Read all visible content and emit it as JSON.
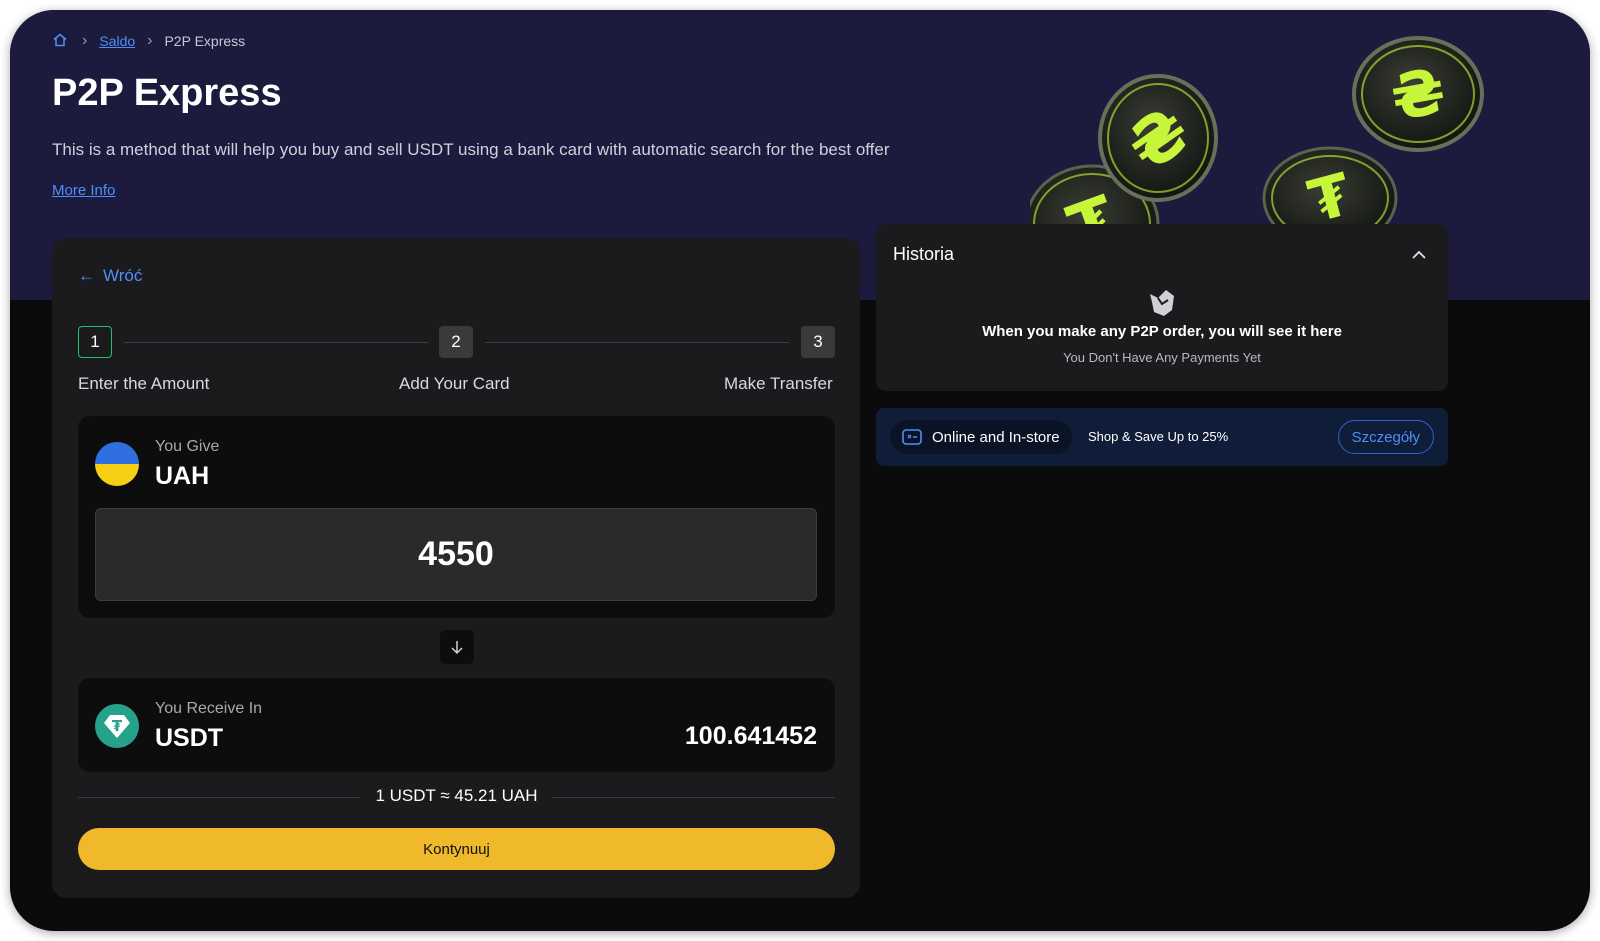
{
  "breadcrumb": {
    "home": "home",
    "saldo": "Saldo",
    "current": "P2P Express"
  },
  "hero": {
    "title": "P2P Express",
    "description": "This is a method that will help you buy and sell USDT using a bank card with automatic search for the best offer",
    "more_info": "More Info"
  },
  "form": {
    "back": "Wróć",
    "steps": [
      {
        "number": "1",
        "label": "Enter the Amount"
      },
      {
        "number": "2",
        "label": "Add Your Card"
      },
      {
        "number": "3",
        "label": "Make Transfer"
      }
    ],
    "active_step": 1,
    "give": {
      "label": "You Give",
      "currency": "UAH",
      "amount": "4550"
    },
    "receive": {
      "label": "You Receive In",
      "currency": "USDT",
      "amount": "100.641452"
    },
    "rate": "1 USDT ≈ 45.21 UAH",
    "continue": "Kontynuuj"
  },
  "history": {
    "title": "Historia",
    "empty_title": "When you make any P2P order, you will see it here",
    "empty_subtitle": "You Don't Have Any Payments Yet"
  },
  "promo": {
    "pill": "Online and In-store",
    "text": "Shop & Save Up to 25%",
    "button": "Szczegóły"
  },
  "colors": {
    "hero_bg": "#1c1b3d",
    "accent_blue": "#4d8ff7",
    "accent_yellow": "#f0b92b",
    "step_active": "#24c06a",
    "coin_green": "#c6f53a"
  }
}
